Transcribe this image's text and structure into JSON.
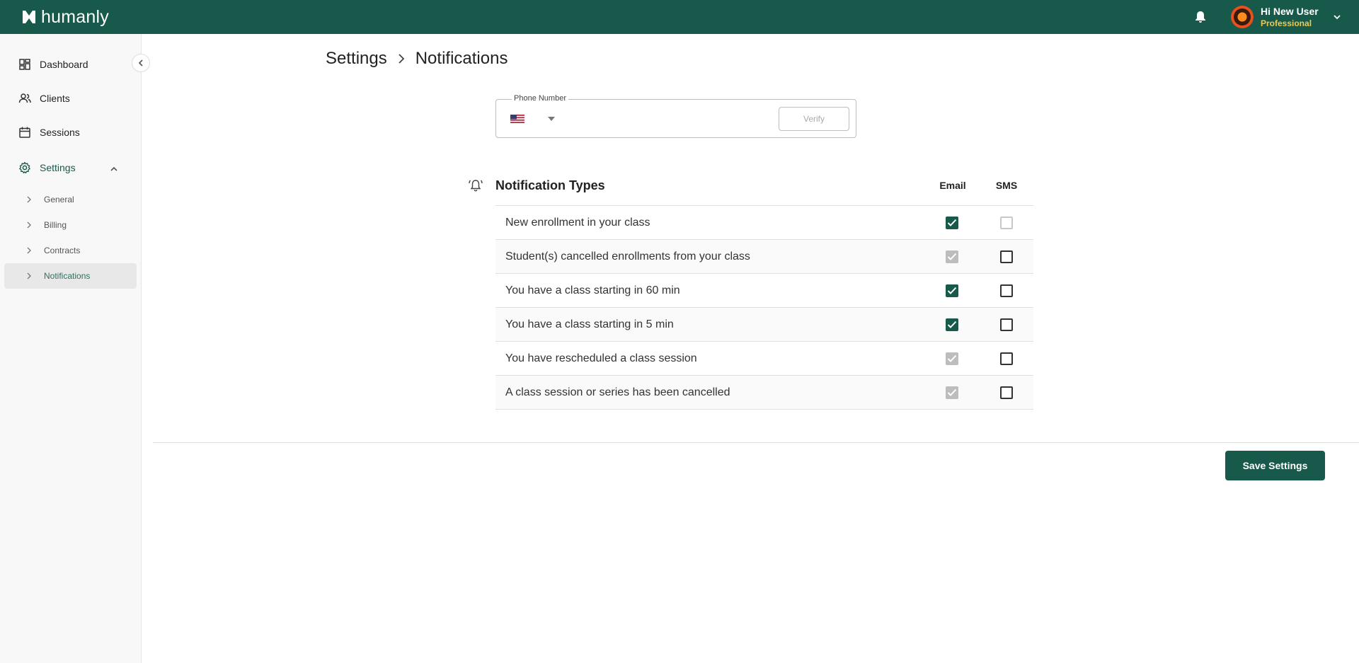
{
  "brand": {
    "name": "humanly"
  },
  "header": {
    "user_greeting": "Hi New User",
    "user_plan": "Professional"
  },
  "sidebar": {
    "items": [
      {
        "label": "Dashboard",
        "icon": "dashboard-icon"
      },
      {
        "label": "Clients",
        "icon": "clients-icon"
      },
      {
        "label": "Sessions",
        "icon": "calendar-icon"
      },
      {
        "label": "Settings",
        "icon": "gear-icon",
        "expanded": true
      }
    ],
    "settings_subitems": [
      {
        "label": "General"
      },
      {
        "label": "Billing"
      },
      {
        "label": "Contracts"
      },
      {
        "label": "Notifications",
        "active": true
      }
    ]
  },
  "breadcrumb": {
    "parent": "Settings",
    "current": "Notifications"
  },
  "phone": {
    "label": "Phone Number",
    "value": "",
    "country": "US",
    "verify_label": "Verify"
  },
  "notifications": {
    "title": "Notification Types",
    "email_header": "Email",
    "sms_header": "SMS",
    "rows": [
      {
        "label": "New enrollment in your class",
        "email": "checked",
        "sms": "unchecked-disabled"
      },
      {
        "label": "Student(s) cancelled enrollments from your class",
        "email": "checked-disabled",
        "sms": "unchecked"
      },
      {
        "label": "You have a class starting in 60 min",
        "email": "checked",
        "sms": "unchecked"
      },
      {
        "label": "You have a class starting in 5 min",
        "email": "checked",
        "sms": "unchecked"
      },
      {
        "label": "You have rescheduled a class session",
        "email": "checked-disabled",
        "sms": "unchecked"
      },
      {
        "label": "A class session or series has been cancelled",
        "email": "checked-disabled",
        "sms": "unchecked"
      }
    ]
  },
  "actions": {
    "save_label": "Save Settings"
  },
  "colors": {
    "primary": "#17594a",
    "accent": "#f2c94c"
  }
}
